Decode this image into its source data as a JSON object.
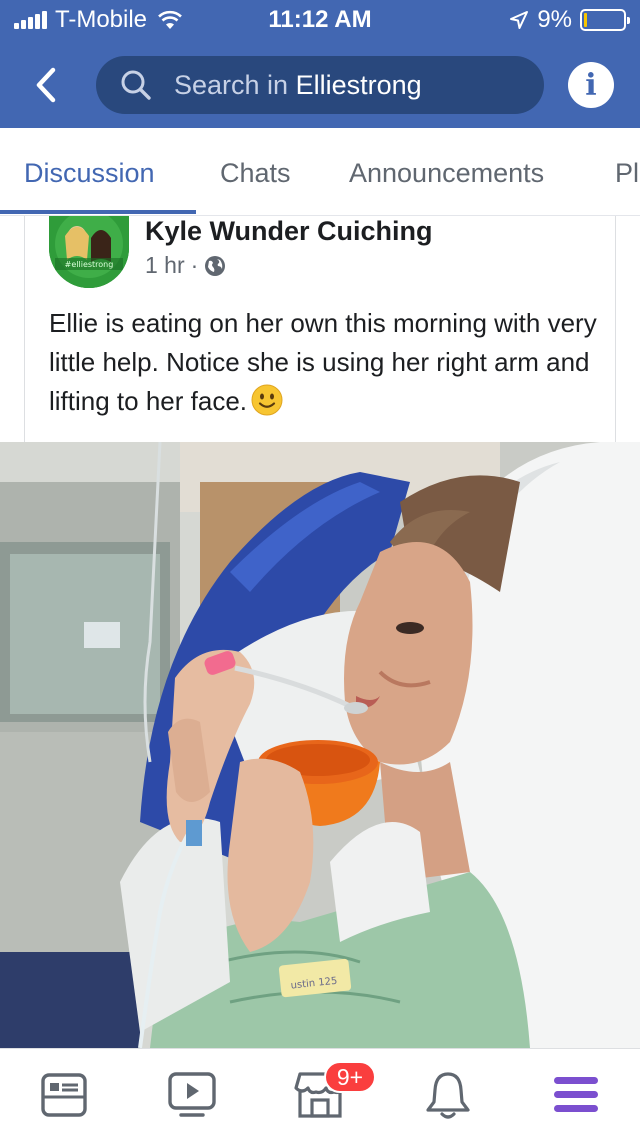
{
  "status_bar": {
    "carrier": "T-Mobile",
    "time": "11:12 AM",
    "battery": "9%",
    "battery_level": 0.09
  },
  "header": {
    "search_prefix": "Search in ",
    "search_group": "Elliestrong"
  },
  "tabs": [
    {
      "label": "Discussion",
      "active": true
    },
    {
      "label": "Chats",
      "active": false
    },
    {
      "label": "Announcements",
      "active": false
    },
    {
      "label": "Pl",
      "active": false
    }
  ],
  "post": {
    "author": "Kyle Wunder Cuiching",
    "time": "1 hr",
    "separator": "·",
    "text": "Ellie is eating on her own this morning with very little help. Notice she is using her right arm and lifting to her face.",
    "avatar_text": "#elliestrong"
  },
  "bottom_bar": {
    "marketplace_badge": "9+"
  },
  "colors": {
    "brand": "#4267b2",
    "search_bg": "#29487d",
    "badge": "#fa3e3e",
    "menu_active": "#7b4fcf"
  },
  "icons": [
    "back-arrow-icon",
    "search-icon",
    "info-icon",
    "globe-icon",
    "smile-emoji-icon",
    "news-feed-icon",
    "watch-icon",
    "marketplace-icon",
    "bell-icon",
    "menu-icon"
  ]
}
